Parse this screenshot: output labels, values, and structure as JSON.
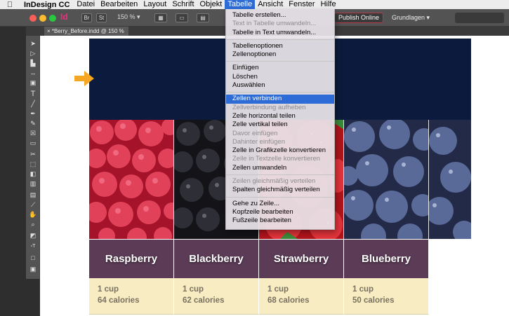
{
  "menubar": {
    "app_name": "InDesign CC",
    "items": [
      "Datei",
      "Bearbeiten",
      "Layout",
      "Schrift",
      "Objekt",
      "Tabelle",
      "Ansicht",
      "Fenster",
      "Hilfe"
    ],
    "active": "Tabelle"
  },
  "appbar": {
    "logo": "Id",
    "zoom": "150 %",
    "publish_label": "Publish Online",
    "workspace_label": "Grundlagen ▾",
    "br_label": "Br",
    "st_label": "St"
  },
  "document": {
    "tab_title": "*Berry_Before.indd @ 150 %"
  },
  "table_menu": {
    "groups": [
      [
        {
          "label": "Tabelle erstellen...",
          "enabled": true
        },
        {
          "label": "Text in Tabelle umwandeln...",
          "enabled": false
        },
        {
          "label": "Tabelle in Text umwandeln...",
          "enabled": true
        }
      ],
      [
        {
          "label": "Tabellenoptionen",
          "enabled": true
        },
        {
          "label": "Zellenoptionen",
          "enabled": true
        }
      ],
      [
        {
          "label": "Einfügen",
          "enabled": true
        },
        {
          "label": "Löschen",
          "enabled": true
        },
        {
          "label": "Auswählen",
          "enabled": true
        }
      ],
      [
        {
          "label": "Zellen verbinden",
          "enabled": true,
          "highlighted": true
        },
        {
          "label": "Zellverbindung aufheben",
          "enabled": false
        },
        {
          "label": "Zelle horizontal teilen",
          "enabled": true
        },
        {
          "label": "Zelle vertikal teilen",
          "enabled": true
        },
        {
          "label": "Davor einfügen",
          "enabled": false
        },
        {
          "label": "Dahinter einfügen",
          "enabled": false
        },
        {
          "label": "Zelle in Grafikzelle konvertieren",
          "enabled": true
        },
        {
          "label": "Zelle in Textzelle konvertieren",
          "enabled": false
        },
        {
          "label": "Zellen umwandeln",
          "enabled": true
        }
      ],
      [
        {
          "label": "Zeilen gleichmäßig verteilen",
          "enabled": false
        },
        {
          "label": "Spalten gleichmäßig verteilen",
          "enabled": true
        }
      ],
      [
        {
          "label": "Gehe zu Zeile...",
          "enabled": true
        },
        {
          "label": "Kopfzeile bearbeiten",
          "enabled": true
        },
        {
          "label": "Fußzeile bearbeiten",
          "enabled": true
        }
      ]
    ]
  },
  "berries": [
    {
      "name": "Raspberry",
      "amount": "1 cup",
      "calories": "64 calories"
    },
    {
      "name": "Blackberry",
      "amount": "1 cup",
      "calories": "62 calories"
    },
    {
      "name": "Strawberry",
      "amount": "1 cup",
      "calories": "68 calories"
    },
    {
      "name": "Blueberry",
      "amount": "1 cup",
      "calories": "50 calories"
    }
  ],
  "colors": {
    "header_block": "#0c1b3d",
    "name_row": "#5b3b56",
    "info_row": "#f8ecc2",
    "menu_highlight": "#2d6bd6",
    "arrow": "#f5a623",
    "publish_border": "#b9394a"
  },
  "icons": [
    "apple-icon",
    "close-icon",
    "minimize-icon",
    "zoom-icon",
    "arrow-right-icon",
    "selection-tool-icon",
    "type-tool-icon",
    "pen-tool-icon",
    "rectangle-tool-icon",
    "zoom-tool-icon"
  ]
}
